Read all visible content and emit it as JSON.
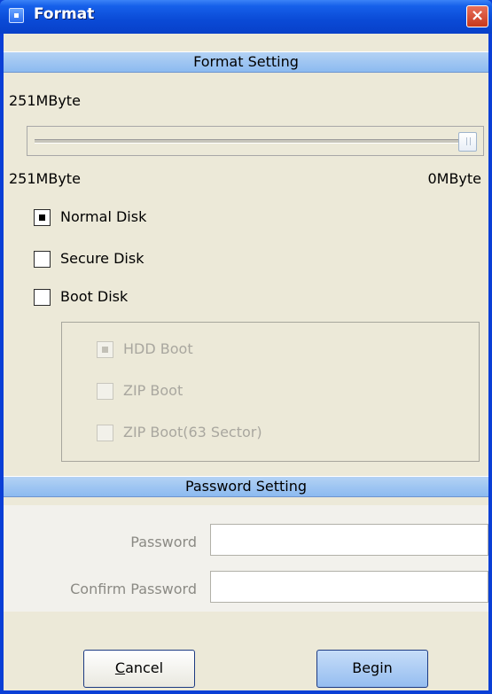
{
  "window": {
    "title": "Format",
    "close_symbol": "×"
  },
  "format_setting": {
    "header": "Format Setting",
    "size_label": "251MByte",
    "slider_value_fraction": 1.0,
    "min_label": "251MByte",
    "max_label": "0MByte"
  },
  "disk_types": [
    {
      "label": "Normal Disk",
      "checked": true
    },
    {
      "label": "Secure Disk",
      "checked": false
    },
    {
      "label": "Boot Disk",
      "checked": false
    }
  ],
  "boot_options": [
    {
      "label": "HDD Boot",
      "checked": true,
      "disabled": true
    },
    {
      "label": "ZIP Boot",
      "checked": false,
      "disabled": true
    },
    {
      "label": "ZIP Boot(63 Sector)",
      "checked": false,
      "disabled": true
    }
  ],
  "password_setting": {
    "header": "Password Setting",
    "password_label": "Password",
    "password_value": "",
    "confirm_label": "Confirm Password",
    "confirm_value": ""
  },
  "buttons": {
    "cancel_label_rest": "ancel",
    "cancel_mnemonic": "C",
    "begin_label": "Begin"
  },
  "colors": {
    "titlebar": "#0a4ad6",
    "client_bg": "#ece9d8",
    "section_header": "#a3c7f2"
  },
  "icons": {
    "system_menu": "system-menu-icon",
    "close": "close-icon"
  }
}
